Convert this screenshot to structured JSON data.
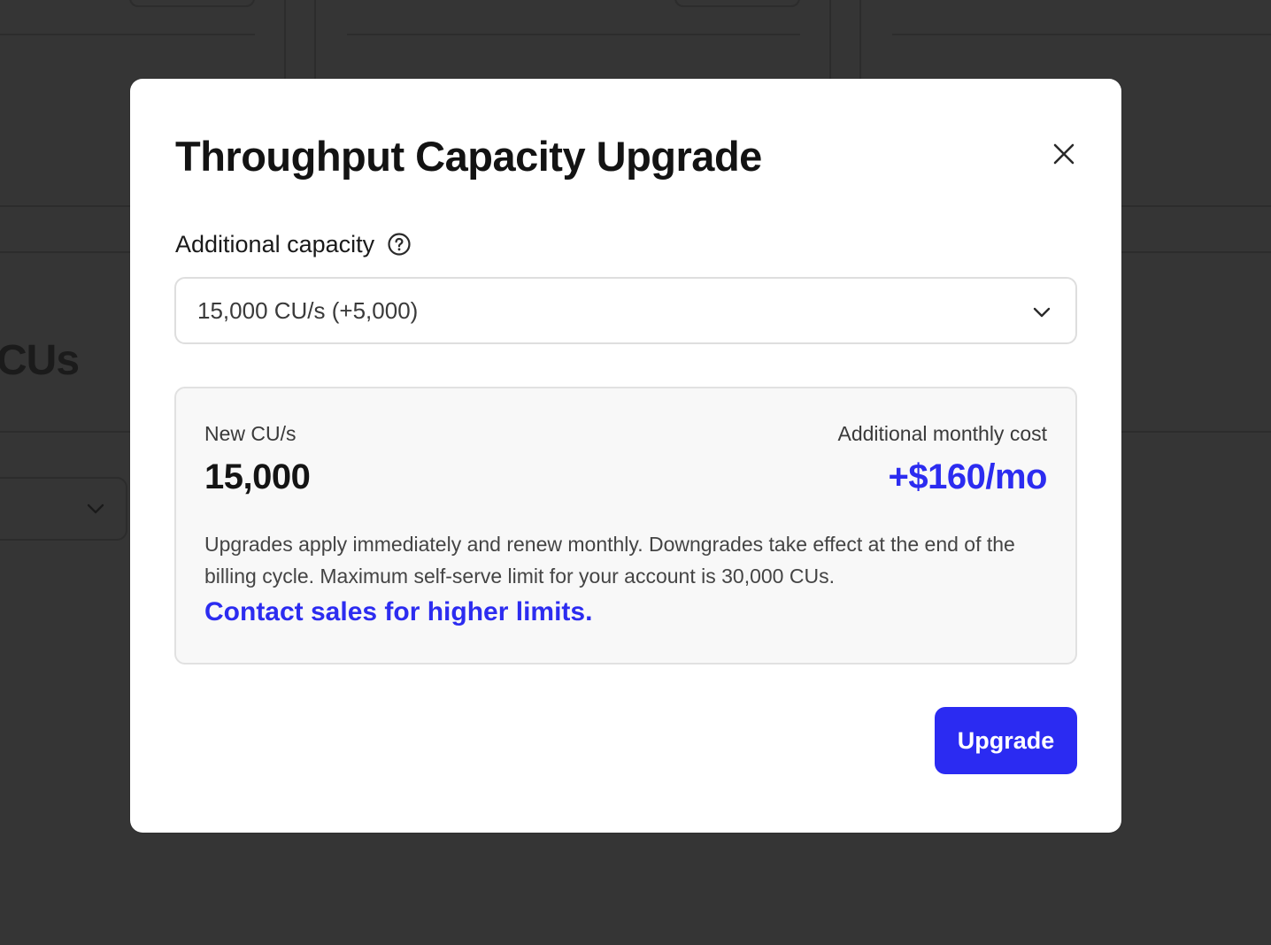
{
  "background": {
    "heading_fragment": "CUs"
  },
  "modal": {
    "title": "Throughput Capacity Upgrade",
    "close_icon": "close-icon",
    "capacity_field": {
      "label": "Additional capacity",
      "help_icon": "help-circle-icon",
      "selected_value": "15,000 CU/s (+5,000)",
      "chevron_icon": "chevron-down-icon"
    },
    "summary": {
      "new_label": "New CU/s",
      "new_value": "15,000",
      "cost_label": "Additional monthly cost",
      "cost_value": "+$160/mo",
      "note": "Upgrades apply immediately and renew monthly. Downgrades take effect at the end of the billing cycle. Maximum self-serve limit for your account is 30,000 CUs.",
      "link_text": "Contact sales for higher limits."
    },
    "upgrade_label": "Upgrade"
  },
  "colors": {
    "accent": "#2b2bf2",
    "overlay": "#353535",
    "panel": "#f8f8f8"
  }
}
